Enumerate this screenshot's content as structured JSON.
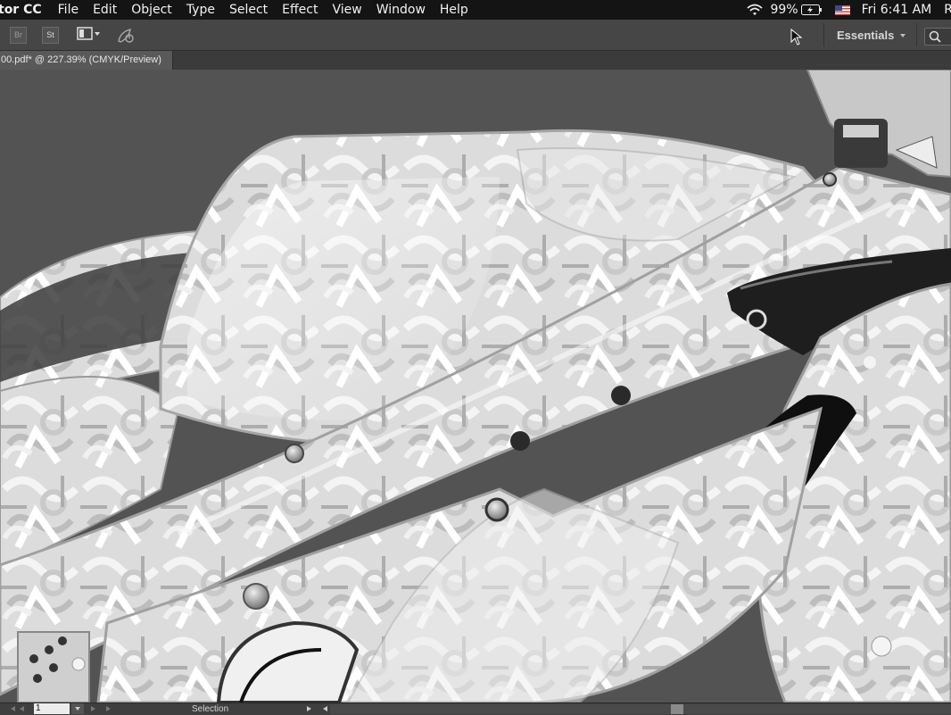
{
  "menubar": {
    "app_name": "tor CC",
    "items": [
      "File",
      "Edit",
      "Object",
      "Type",
      "Select",
      "Effect",
      "View",
      "Window",
      "Help"
    ],
    "battery": "99%",
    "clock": "Fri 6:41 AM",
    "user_initial": "R"
  },
  "control_bar": {
    "bridge_label": "Br",
    "stock_label": "St",
    "workspace": "Essentials",
    "search_placeholder": ""
  },
  "document": {
    "tab_title": "00.pdf* @ 227.39% (CMYK/Preview)"
  },
  "status_bar": {
    "artboard_number": "1",
    "current_tool": "Selection"
  },
  "colors": {
    "menubar_bg": "#141414",
    "toolbar_bg": "#464646",
    "canvas_bg": "#535353",
    "artwork_light": "#e6e6e6"
  }
}
